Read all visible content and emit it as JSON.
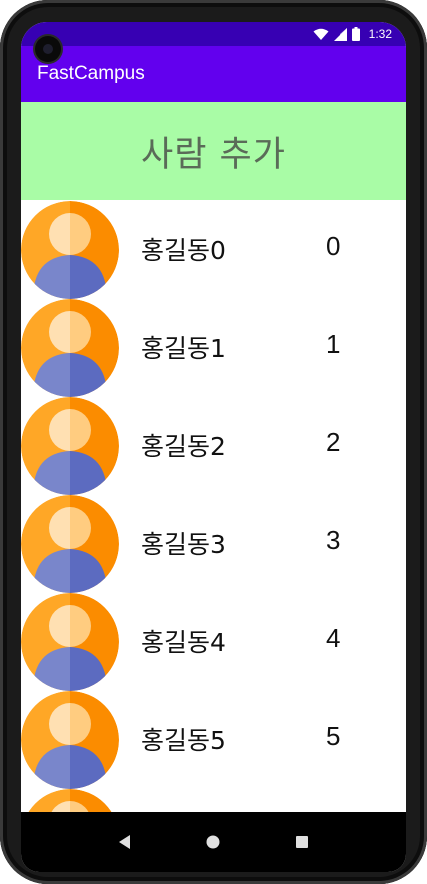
{
  "status_bar": {
    "time": "1:32",
    "icons": [
      "wifi-icon",
      "signal-icon",
      "battery-icon"
    ],
    "color": "#3700b3"
  },
  "app_bar": {
    "title": "FastCampus",
    "color": "#6200ee"
  },
  "add_button": {
    "label": "사람 추가",
    "color": "#a9fca6"
  },
  "people": [
    {
      "name": "홍길동0",
      "number": "0",
      "icon": "person-avatar-icon"
    },
    {
      "name": "홍길동1",
      "number": "1",
      "icon": "person-avatar-icon"
    },
    {
      "name": "홍길동2",
      "number": "2",
      "icon": "person-avatar-icon"
    },
    {
      "name": "홍길동3",
      "number": "3",
      "icon": "person-avatar-icon"
    },
    {
      "name": "홍길동4",
      "number": "4",
      "icon": "person-avatar-icon"
    },
    {
      "name": "홍길동5",
      "number": "5",
      "icon": "person-avatar-icon"
    },
    {
      "name": "",
      "number": "",
      "icon": "person-avatar-icon"
    }
  ],
  "nav_bar": {
    "buttons": [
      "back-icon",
      "home-icon",
      "recents-icon"
    ]
  }
}
